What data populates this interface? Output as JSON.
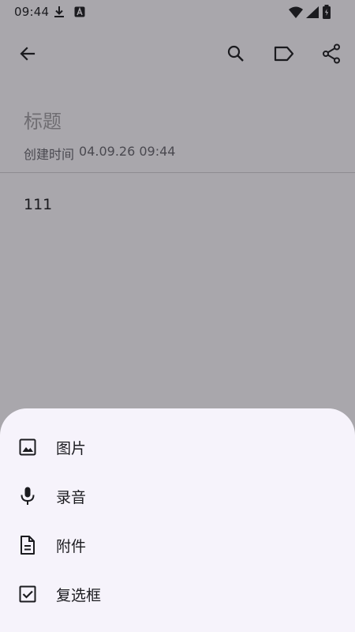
{
  "status_bar": {
    "time": "09:44",
    "icons_left": [
      "download-icon",
      "a-badge-icon"
    ],
    "icons_right": [
      "wifi-icon",
      "signal-icon",
      "battery-icon"
    ]
  },
  "toolbar": {
    "icons": [
      "back-arrow-icon",
      "search-icon",
      "label-icon",
      "share-icon"
    ]
  },
  "note": {
    "title_placeholder": "标题",
    "created_label": "创建时间",
    "created_value": "04.09.26 09:44",
    "body": "111"
  },
  "bottom_sheet": {
    "items": [
      {
        "label": "图片",
        "icon": "image-icon"
      },
      {
        "label": "录音",
        "icon": "microphone-icon"
      },
      {
        "label": "附件",
        "icon": "document-icon"
      },
      {
        "label": "复选框",
        "icon": "checkbox-icon"
      }
    ]
  },
  "colors": {
    "scrim": "#a9a7ac",
    "sheet_bg": "#f6f3fb",
    "text_dark": "#1b1b1f"
  }
}
